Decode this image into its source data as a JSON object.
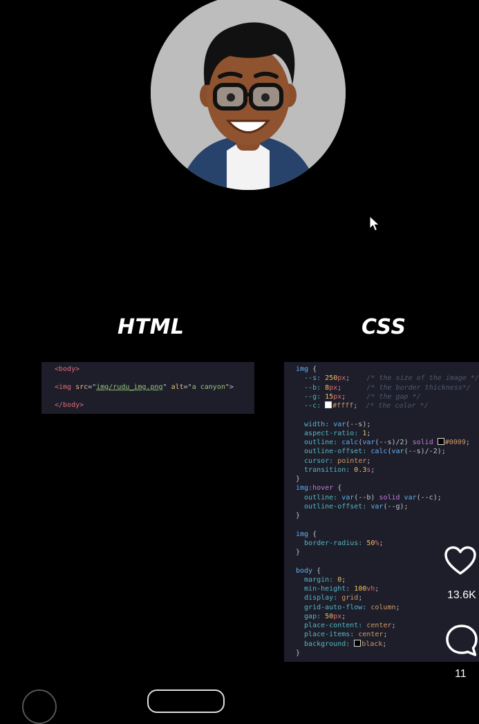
{
  "headings": {
    "html": "HTML",
    "css": "CSS"
  },
  "html_code": [
    [
      {
        "t": "<body>",
        "c": "t-tag"
      }
    ],
    [
      {
        "t": "<img ",
        "c": "t-tag"
      },
      {
        "t": "src",
        "c": "t-attr"
      },
      {
        "t": "=\"",
        "c": "t-punc"
      },
      {
        "t": "img/rudu_img.png",
        "c": "t-str"
      },
      {
        "t": "\" ",
        "c": "t-punc"
      },
      {
        "t": "alt",
        "c": "t-attr"
      },
      {
        "t": "=\"",
        "c": "t-punc"
      },
      {
        "t": "a canyon",
        "c": "t-str2"
      },
      {
        "t": "\">",
        "c": "t-punc"
      }
    ],
    [
      {
        "t": "</body>",
        "c": "t-tag"
      }
    ]
  ],
  "css_code": [
    [
      {
        "t": "img ",
        "c": "t-sel"
      },
      {
        "t": "{",
        "c": "t-punc"
      }
    ],
    [
      {
        "t": "  --s: ",
        "c": "t-prop"
      },
      {
        "t": "250",
        "c": "t-num"
      },
      {
        "t": "px",
        "c": "t-unit"
      },
      {
        "t": ";    ",
        "c": "t-punc"
      },
      {
        "t": "/* the size of the image */",
        "c": "t-com"
      }
    ],
    [
      {
        "t": "  --b: ",
        "c": "t-prop"
      },
      {
        "t": "8",
        "c": "t-num"
      },
      {
        "t": "px",
        "c": "t-unit"
      },
      {
        "t": ";      ",
        "c": "t-punc"
      },
      {
        "t": "/* the border thickness*/",
        "c": "t-com"
      }
    ],
    [
      {
        "t": "  --g: ",
        "c": "t-prop"
      },
      {
        "t": "15",
        "c": "t-num"
      },
      {
        "t": "px",
        "c": "t-unit"
      },
      {
        "t": ";     ",
        "c": "t-punc"
      },
      {
        "t": "/* the gap */",
        "c": "t-com"
      }
    ],
    [
      {
        "t": "  --c: ",
        "c": "t-prop"
      },
      {
        "sw": "#ffffff"
      },
      {
        "t": "#ffff",
        "c": "t-val"
      },
      {
        "t": ";  ",
        "c": "t-punc"
      },
      {
        "t": "/* the color */",
        "c": "t-com"
      }
    ],
    [
      {
        "t": "",
        "c": "t-punc"
      }
    ],
    [
      {
        "t": "  width: ",
        "c": "t-prop"
      },
      {
        "t": "var",
        "c": "t-fn"
      },
      {
        "t": "(--s);",
        "c": "t-punc"
      }
    ],
    [
      {
        "t": "  aspect-ratio: ",
        "c": "t-prop"
      },
      {
        "t": "1",
        "c": "t-num"
      },
      {
        "t": ";",
        "c": "t-punc"
      }
    ],
    [
      {
        "t": "  outline: ",
        "c": "t-prop"
      },
      {
        "t": "calc",
        "c": "t-fn"
      },
      {
        "t": "(",
        "c": "t-punc"
      },
      {
        "t": "var",
        "c": "t-fn"
      },
      {
        "t": "(--s)/2) ",
        "c": "t-punc"
      },
      {
        "t": "solid ",
        "c": "t-kw"
      },
      {
        "sw": "#000000"
      },
      {
        "t": "#0009",
        "c": "t-val"
      },
      {
        "t": ";",
        "c": "t-punc"
      }
    ],
    [
      {
        "t": "  outline-offset: ",
        "c": "t-prop"
      },
      {
        "t": "calc",
        "c": "t-fn"
      },
      {
        "t": "(",
        "c": "t-punc"
      },
      {
        "t": "var",
        "c": "t-fn"
      },
      {
        "t": "(--s)/-2);",
        "c": "t-punc"
      }
    ],
    [
      {
        "t": "  cursor: ",
        "c": "t-prop"
      },
      {
        "t": "pointer",
        "c": "t-val"
      },
      {
        "t": ";",
        "c": "t-punc"
      }
    ],
    [
      {
        "t": "  transition: ",
        "c": "t-prop"
      },
      {
        "t": "0.3",
        "c": "t-num"
      },
      {
        "t": "s",
        "c": "t-unit"
      },
      {
        "t": ";",
        "c": "t-punc"
      }
    ],
    [
      {
        "t": "}",
        "c": "t-punc"
      }
    ],
    [
      {
        "t": "img",
        "c": "t-sel"
      },
      {
        "t": ":hover ",
        "c": "t-kw"
      },
      {
        "t": "{",
        "c": "t-punc"
      }
    ],
    [
      {
        "t": "  outline: ",
        "c": "t-prop"
      },
      {
        "t": "var",
        "c": "t-fn"
      },
      {
        "t": "(--b) ",
        "c": "t-punc"
      },
      {
        "t": "solid ",
        "c": "t-kw"
      },
      {
        "t": "var",
        "c": "t-fn"
      },
      {
        "t": "(--c);",
        "c": "t-punc"
      }
    ],
    [
      {
        "t": "  outline-offset: ",
        "c": "t-prop"
      },
      {
        "t": "var",
        "c": "t-fn"
      },
      {
        "t": "(--g);",
        "c": "t-punc"
      }
    ],
    [
      {
        "t": "}",
        "c": "t-punc"
      }
    ],
    [
      {
        "t": "",
        "c": "t-punc"
      }
    ],
    [
      {
        "t": "img ",
        "c": "t-sel"
      },
      {
        "t": "{",
        "c": "t-punc"
      }
    ],
    [
      {
        "t": "  border-radius: ",
        "c": "t-prop"
      },
      {
        "t": "50",
        "c": "t-num"
      },
      {
        "t": "%",
        "c": "t-unit"
      },
      {
        "t": ";",
        "c": "t-punc"
      }
    ],
    [
      {
        "t": "}",
        "c": "t-punc"
      }
    ],
    [
      {
        "t": "",
        "c": "t-punc"
      }
    ],
    [
      {
        "t": "body ",
        "c": "t-sel"
      },
      {
        "t": "{",
        "c": "t-punc"
      }
    ],
    [
      {
        "t": "  margin: ",
        "c": "t-prop"
      },
      {
        "t": "0",
        "c": "t-num"
      },
      {
        "t": ";",
        "c": "t-punc"
      }
    ],
    [
      {
        "t": "  min-height: ",
        "c": "t-prop"
      },
      {
        "t": "100",
        "c": "t-num"
      },
      {
        "t": "vh",
        "c": "t-unit"
      },
      {
        "t": ";",
        "c": "t-punc"
      }
    ],
    [
      {
        "t": "  display: ",
        "c": "t-prop"
      },
      {
        "t": "grid",
        "c": "t-val"
      },
      {
        "t": ";",
        "c": "t-punc"
      }
    ],
    [
      {
        "t": "  grid-auto-flow: ",
        "c": "t-prop"
      },
      {
        "t": "column",
        "c": "t-val"
      },
      {
        "t": ";",
        "c": "t-punc"
      }
    ],
    [
      {
        "t": "  gap: ",
        "c": "t-prop"
      },
      {
        "t": "50",
        "c": "t-num"
      },
      {
        "t": "px",
        "c": "t-unit"
      },
      {
        "t": ";",
        "c": "t-punc"
      }
    ],
    [
      {
        "t": "  place-content: ",
        "c": "t-prop"
      },
      {
        "t": "center",
        "c": "t-val"
      },
      {
        "t": ";",
        "c": "t-punc"
      }
    ],
    [
      {
        "t": "  place-items: ",
        "c": "t-prop"
      },
      {
        "t": "center",
        "c": "t-val"
      },
      {
        "t": ";",
        "c": "t-punc"
      }
    ],
    [
      {
        "t": "  background: ",
        "c": "t-prop"
      },
      {
        "sw": "#000000"
      },
      {
        "t": "black",
        "c": "t-val"
      },
      {
        "t": ";",
        "c": "t-punc"
      }
    ],
    [
      {
        "t": "}",
        "c": "t-punc"
      }
    ]
  ],
  "actions": {
    "like_count": "13.6K",
    "comment_count": "11"
  },
  "icons": {
    "like": "heart-icon",
    "comment": "comment-bubble-icon",
    "cursor": "mouse-pointer-icon"
  }
}
